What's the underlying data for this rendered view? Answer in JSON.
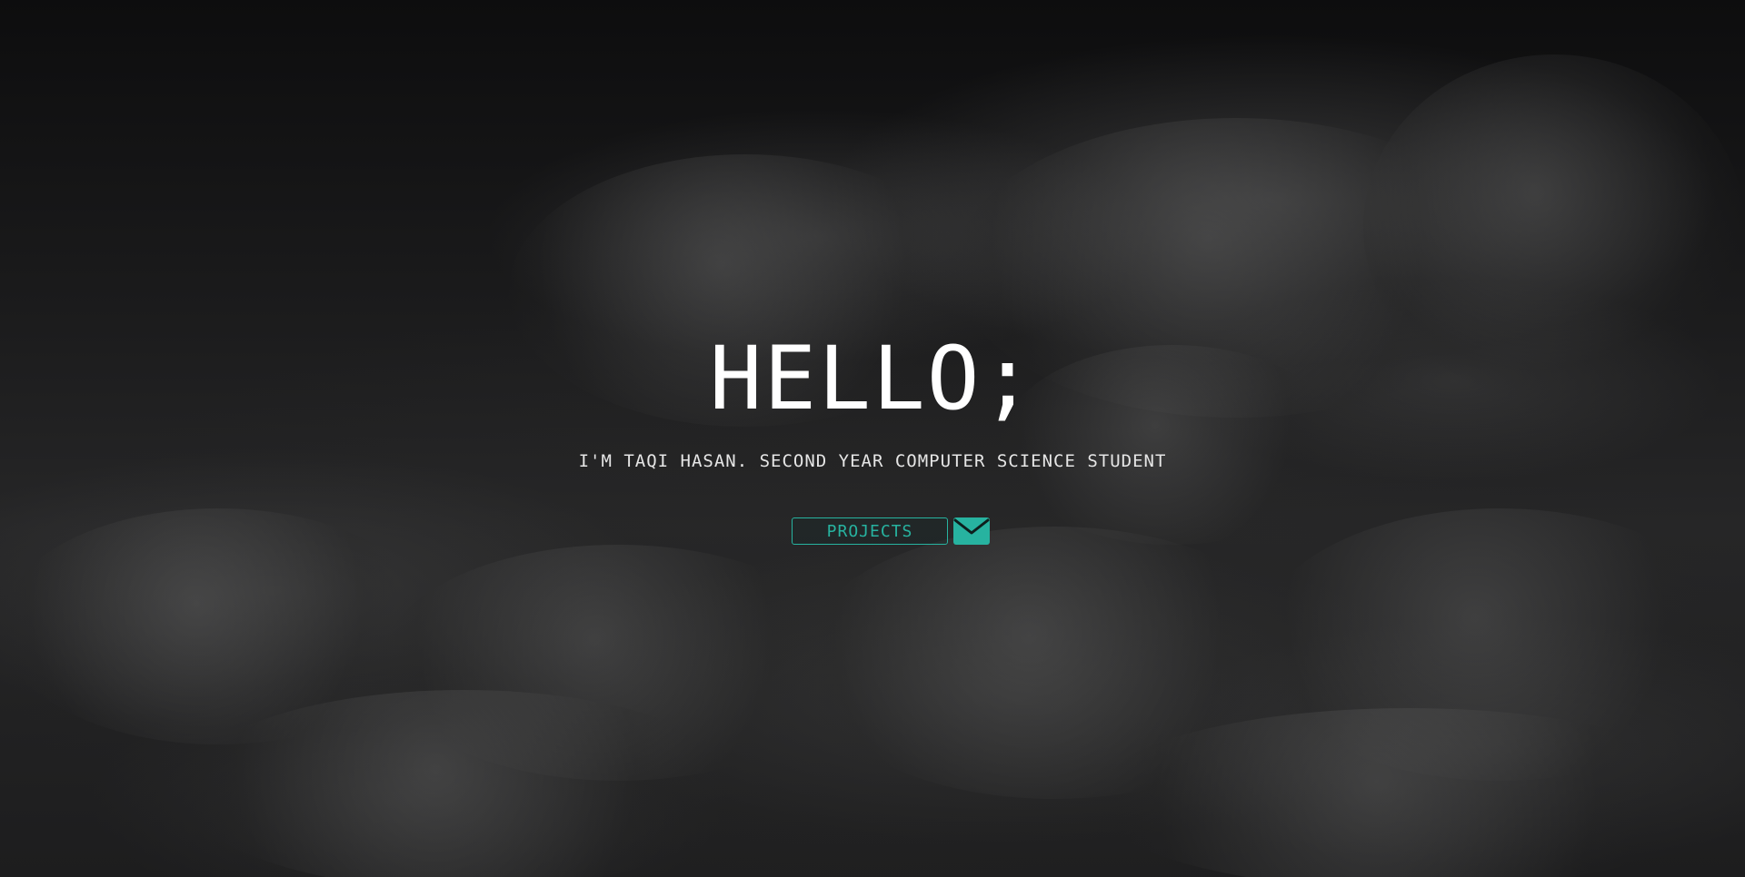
{
  "hero": {
    "title": "HELLO;",
    "subtitle": "I'M TAQI HASAN. SECOND YEAR COMPUTER SCIENCE STUDENT",
    "background": "dark-clouds"
  },
  "actions": {
    "projects_label": "PROJECTS",
    "mail_icon": "envelope-icon"
  },
  "colors": {
    "accent": "#27b3a0",
    "title": "#ffffff",
    "subtitle": "#e6e6e6",
    "background": "#0c0c0d"
  }
}
